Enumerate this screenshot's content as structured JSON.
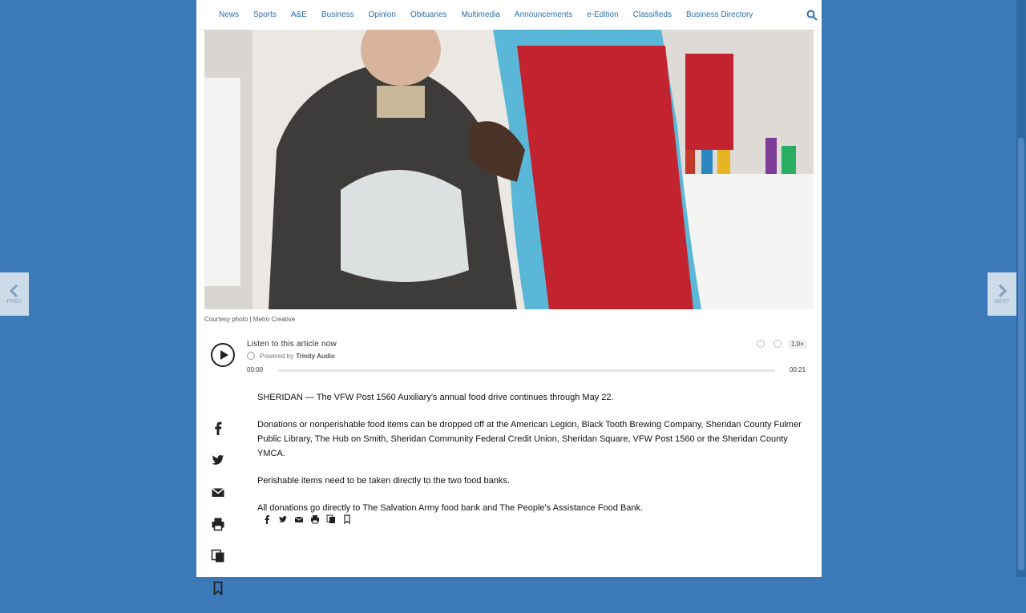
{
  "nav": {
    "items": [
      "News",
      "Sports",
      "A&E",
      "Business",
      "Opinion",
      "Obituaries",
      "Multimedia",
      "Announcements",
      "e-Edition",
      "Classifieds",
      "Business Directory"
    ],
    "search_icon": "search-icon"
  },
  "hero": {
    "caption": "Courtesy photo | Metro Creative"
  },
  "audio": {
    "listen": "Listen to this article now",
    "powered_prefix": "Powered by",
    "powered_brand": "Trinity Audio",
    "time_start": "00:00",
    "time_end": "00:21",
    "speed": "1.0×"
  },
  "article": {
    "paragraphs": [
      "SHERIDAN — The VFW Post 1560 Auxiliary's annual food drive continues through May 22.",
      "Donations or nonperishable food items can be dropped off at the American Legion, Black Tooth Brewing Company, Sheridan County Fulmer Public Library, The Hub on Smith, Sheridan Community Federal Credit Union, Sheridan Square, VFW Post 1560 or the Sheridan County YMCA.",
      "Perishable items need to be taken directly to the two food banks.",
      "All donations go directly to The Salvation Army food bank and The People's Assistance Food Bank."
    ]
  },
  "share_icons": [
    "facebook-icon",
    "twitter-icon",
    "email-icon",
    "print-icon",
    "copy-icon",
    "bookmark-icon"
  ],
  "edge_nav": {
    "prev": "PREV",
    "next": "NEXT"
  },
  "colors": {
    "background": "#3b79b8",
    "link": "#2a6fb0",
    "apron": "#c2232e",
    "sweater": "#5ab7d8"
  }
}
